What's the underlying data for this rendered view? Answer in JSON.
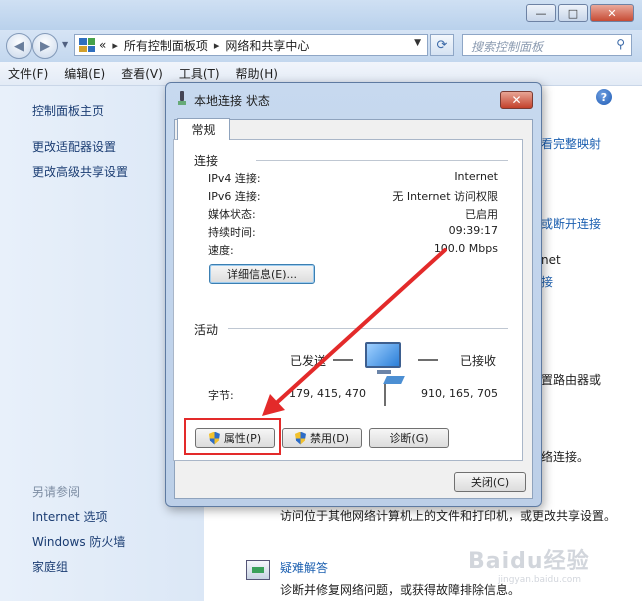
{
  "window": {
    "controls": {
      "minimize": "—",
      "maximize": "□",
      "close": "✕"
    }
  },
  "address_bar": {
    "crumb_prefix": "«",
    "crumbs": [
      "所有控制面板项",
      "网络和共享中心"
    ],
    "separator": "▸",
    "search_placeholder": "搜索控制面板"
  },
  "menu": [
    "文件(F)",
    "编辑(E)",
    "查看(V)",
    "工具(T)",
    "帮助(H)"
  ],
  "left_pane": {
    "links_top": [
      "控制面板主页",
      "更改适配器设置",
      "更改高级共享设置"
    ],
    "see_also_heading": "另请参阅",
    "links_bottom": [
      "Internet 选项",
      "Windows 防火墙",
      "家庭组"
    ]
  },
  "main_fragments": {
    "f1": "看完整映射",
    "f2": "或断开连接",
    "f3": "net",
    "f4": "接",
    "f5": "置路由器或",
    "f6": "络连接。",
    "share_text": "访问位于其他网络计算机上的文件和打印机，或更改共享设置。",
    "troubleshoot_link": "疑难解答",
    "troubleshoot_desc": "诊断并修复网络问题，或获得故障排除信息。",
    "watermark": "Baidu经验",
    "watermark_sub": "jingyan.baidu.com"
  },
  "dialog": {
    "title": "本地连接 状态",
    "close_glyph": "✕",
    "tab": "常规",
    "connection": {
      "heading": "连接",
      "rows": [
        {
          "label": "IPv4 连接:",
          "value": "Internet"
        },
        {
          "label": "IPv6 连接:",
          "value": "无 Internet 访问权限"
        },
        {
          "label": "媒体状态:",
          "value": "已启用"
        },
        {
          "label": "持续时间:",
          "value": "09:39:17"
        },
        {
          "label": "速度:",
          "value": "100.0 Mbps"
        }
      ],
      "details_button": "详细信息(E)..."
    },
    "activity": {
      "heading": "活动",
      "sent_label": "已发送",
      "received_label": "已接收",
      "bytes_label": "字节:",
      "bytes_sent": "179, 415, 470",
      "bytes_received": "910, 165, 705"
    },
    "buttons": {
      "properties": "属性(P)",
      "disable": "禁用(D)",
      "diagnose": "诊断(G)",
      "close": "关闭(C)"
    }
  },
  "annotation": {
    "highlight_color": "#e32a2a"
  }
}
